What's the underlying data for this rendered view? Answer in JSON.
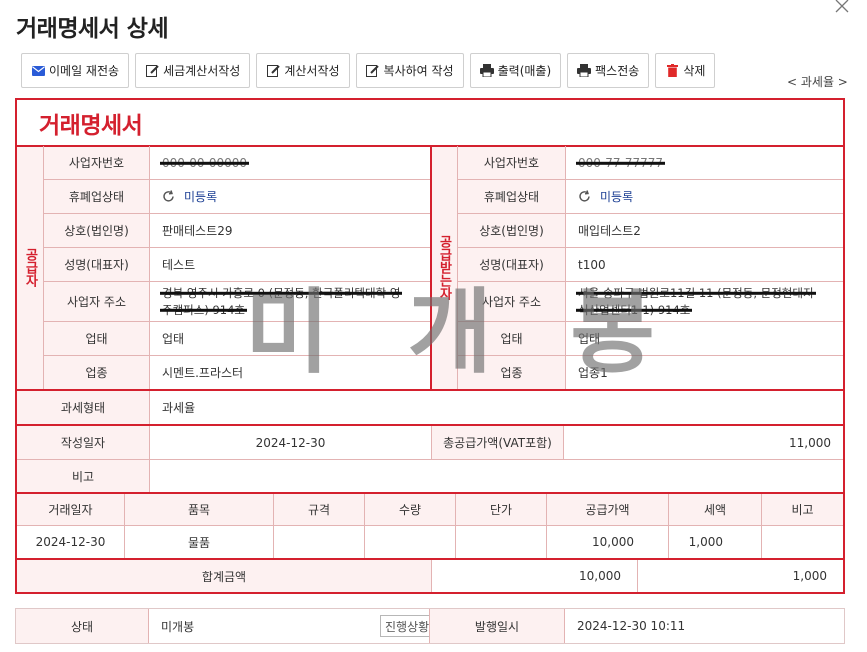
{
  "page": {
    "title": "거래명세서 상세",
    "close_icon": "close-icon"
  },
  "toolbar": {
    "email": "이메일 재전송",
    "tax_invoice": "세금계산서작성",
    "invoice": "계산서작성",
    "copy": "복사하여 작성",
    "print": "출력(매출)",
    "fax": "팩스전송",
    "delete": "삭제"
  },
  "tax_type_link": "< 과세율 >",
  "doc": {
    "title": "거래명세서",
    "supplier_side": "공급자",
    "receiver_side": "공급받는자",
    "labels": {
      "biz_no": "사업자번호",
      "closure": "휴폐업상태",
      "company": "상호(법인명)",
      "ceo": "성명(대표자)",
      "address": "사업자 주소",
      "biz_type": "업태",
      "biz_item": "업종"
    },
    "supplier": {
      "biz_no": "000-00-00000",
      "closure": "미등록",
      "company": "판매테스트29",
      "ceo": "테스트",
      "address_line1": "경북 영주시 가흥로 0 (문정동, 한국폴리텍대학 영",
      "address_line2": "주캠퍼스) 914호",
      "biz_type": "업태",
      "biz_item": "시멘트.프라스터"
    },
    "receiver": {
      "biz_no": "000-77-77777",
      "closure": "미등록",
      "company": "매입테스트2",
      "ceo": "t100",
      "address_line1": "서울 송파구 법원로11길 11 (문정동, 문정현대지",
      "address_line2": "식산업센터1-1) 914호",
      "biz_type": "업태",
      "biz_item": "업종1"
    },
    "tax_form_label": "과세형태",
    "tax_form_value": "과세율",
    "write_date_label": "작성일자",
    "write_date_value": "2024-12-30",
    "total_supply_label": "총공급가액(VAT포함)",
    "total_supply_value": "11,000",
    "note_label": "비고",
    "note_value": "",
    "items_header": {
      "date": "거래일자",
      "item": "품목",
      "spec": "규격",
      "qty": "수량",
      "unit_price": "단가",
      "supply": "공급가액",
      "tax": "세액",
      "remark": "비고"
    },
    "items": [
      {
        "date": "2024-12-30",
        "item": "물품",
        "spec": "",
        "qty": "",
        "unit_price": "",
        "supply": "10,000",
        "tax": "1,000",
        "remark": ""
      }
    ],
    "sum_label": "합계금액",
    "sum_supply": "10,000",
    "sum_tax": "1,000",
    "watermark": "미개봉"
  },
  "status": {
    "label": "상태",
    "value": "미개봉",
    "progress_button": "진행상황",
    "issue_label": "발행일시",
    "issue_value": "2024-12-30 10:11"
  },
  "colors": {
    "accent": "#d4202e",
    "label_bg": "#fdf1f1",
    "link_blue": "#1c3f94"
  }
}
